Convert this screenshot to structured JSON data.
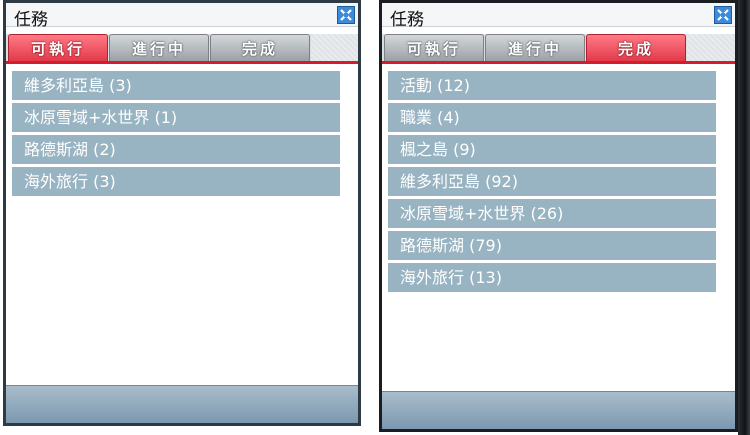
{
  "windows": [
    {
      "title": "任務",
      "close_icon": "close-icon",
      "tabs": [
        {
          "label": "可執行",
          "active": true
        },
        {
          "label": "進行中",
          "active": false
        },
        {
          "label": "完成",
          "active": false
        }
      ],
      "items": [
        "維多利亞島 (3)",
        "冰原雪域+水世界 (1)",
        "路德斯湖 (2)",
        "海外旅行 (3)"
      ]
    },
    {
      "title": "任務",
      "close_icon": "close-icon",
      "tabs": [
        {
          "label": "可執行",
          "active": false
        },
        {
          "label": "進行中",
          "active": false
        },
        {
          "label": "完成",
          "active": true
        }
      ],
      "items": [
        "活動 (12)",
        "職業 (4)",
        "楓之島 (9)",
        "維多利亞島 (92)",
        "冰原雪域+水世界 (26)",
        "路德斯湖 (79)",
        "海外旅行 (13)"
      ]
    }
  ],
  "colors": {
    "tab_active": "#e23a4a",
    "tab_inactive": "#9aa1a6",
    "list_item": "#98b3c1",
    "accent_line": "#d41c2b",
    "close_button": "#3c8ad8"
  }
}
